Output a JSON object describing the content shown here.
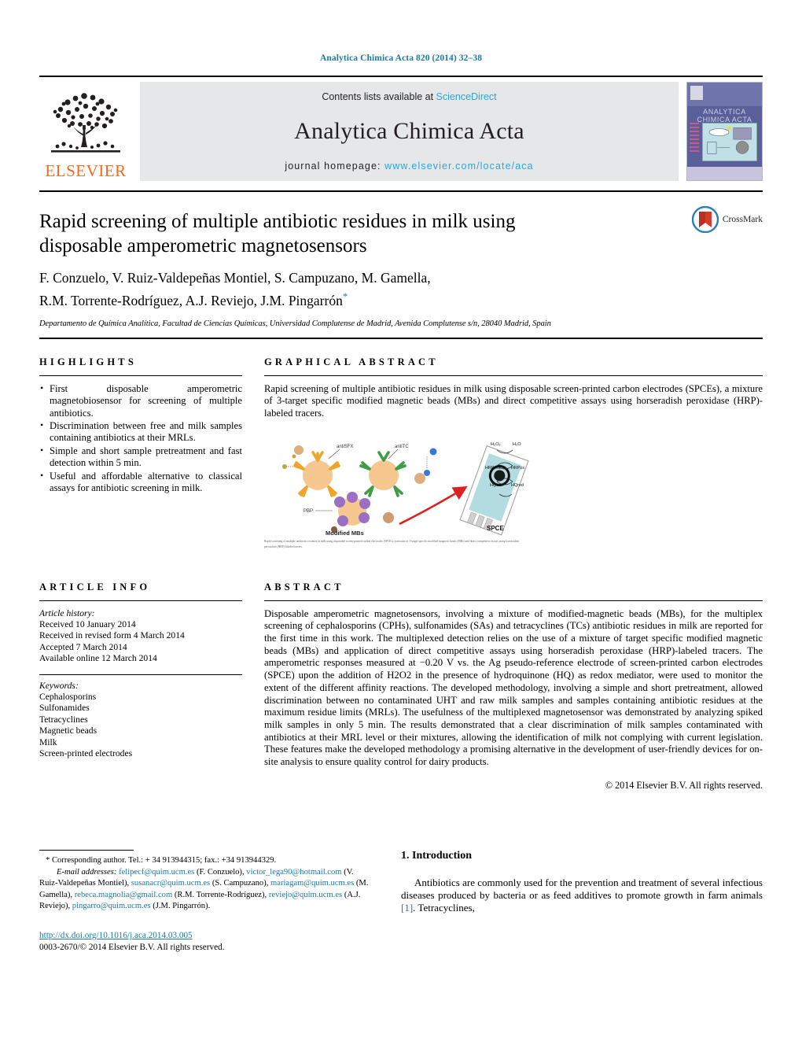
{
  "running_head": "Analytica Chimica Acta 820 (2014) 32–38",
  "masthead": {
    "publisher": "ELSEVIER",
    "contents_prefix": "Contents lists available at ",
    "contents_link": "ScienceDirect",
    "journal_name": "Analytica Chimica Acta",
    "homepage_prefix": "journal homepage: ",
    "homepage_url": "www.elsevier.com/locate/aca",
    "cover_title": "ANALYTICA CHIMICA ACTA",
    "link_color": "#2ba6de"
  },
  "title": "Rapid screening of multiple antibiotic residues in milk using disposable amperometric magnetosensors",
  "authors_line1": "F. Conzuelo, V. Ruiz-Valdepeñas Montiel, S. Campuzano, M. Gamella,",
  "authors_line2": "R.M. Torrente-Rodríguez, A.J. Reviejo, J.M. Pingarrón",
  "affiliation": "Departamento de Química Analítica, Facultad de Ciencias Químicas, Universidad Complutense de Madrid, Avenida Complutense s/n, 28040 Madrid, Spain",
  "crossmark": {
    "label": "CrossMark"
  },
  "highlights": {
    "heading": "HIGHLIGHTS",
    "items": [
      "First disposable amperometric magnetobiosensor for screening of multiple antibiotics.",
      "Discrimination between free and milk samples containing antibiotics at their MRLs.",
      "Simple and short sample pretreatment and fast detection within 5 min.",
      "Useful and affordable alternative to classical assays for antibiotic screening in milk."
    ]
  },
  "graphical_abstract": {
    "heading": "GRAPHICAL ABSTRACT",
    "description": "Rapid screening of multiple antibiotic residues in milk using disposable screen-printed carbon electrodes (SPCEs), a mixture of 3-target specific modified magnetic beads (MBs) and direct competitive assays using horseradish peroxidase (HRP)-labeled tracers.",
    "caption": "Rapid screening of multiple antibiotic residues in milk using disposable screen-printed carbon electrodes (SPCEs), a mixture of 3-target specific modified magnetic beads (MBs) and direct competitive assays using horseradish peroxidase (HRP)-labeled tracers.",
    "figure_labels": {
      "anti_sfy": "antiSFX",
      "anti_tc": "antiTC",
      "pbp": "PBP",
      "modified_mbs": "Modified MBs",
      "spce": "SPCE",
      "h2o2": "H₂O₂",
      "h2o": "H₂O",
      "hrp_red": "HRPred",
      "hrp_ox": "HRPox",
      "hq_ox": "HQox",
      "hq_red": "HQred"
    }
  },
  "article_info": {
    "heading": "ARTICLE INFO",
    "history_label": "Article history:",
    "history": [
      "Received 10 January 2014",
      "Received in revised form 4 March 2014",
      "Accepted 7 March 2014",
      "Available online 12 March 2014"
    ],
    "keywords_label": "Keywords:",
    "keywords": [
      "Cephalosporins",
      "Sulfonamides",
      "Tetracyclines",
      "Magnetic beads",
      "Milk",
      "Screen-printed electrodes"
    ]
  },
  "abstract": {
    "heading": "ABSTRACT",
    "text": "Disposable amperometric magnetosensors, involving a mixture of modified-magnetic beads (MBs), for the multiplex screening of cephalosporins (CPHs), sulfonamides (SAs) and tetracyclines (TCs) antibiotic residues in milk are reported for the first time in this work. The multiplexed detection relies on the use of a mixture of target specific modified magnetic beads (MBs) and application of direct competitive assays using horseradish peroxidase (HRP)-labeled tracers. The amperometric responses measured at −0.20 V vs. the Ag pseudo-reference electrode of screen-printed carbon electrodes (SPCE) upon the addition of H2O2 in the presence of hydroquinone (HQ) as redox mediator, were used to monitor the extent of the different affinity reactions. The developed methodology, involving a simple and short pretreatment, allowed discrimination between no contaminated UHT and raw milk samples and samples containing antibiotic residues at the maximum residue limits (MRLs). The usefulness of the multiplexed magnetosensor was demonstrated by analyzing spiked milk samples in only 5 min. The results demonstrated that a clear discrimination of milk samples contaminated with antibiotics at their MRL level or their mixtures, allowing the identification of milk not complying with current legislation. These features make the developed methodology a promising alternative in the development of user-friendly devices for on-site analysis to ensure quality control for dairy products.",
    "copyright": "© 2014 Elsevier B.V. All rights reserved."
  },
  "footnote": {
    "corresponding": "* Corresponding author. Tel.: + 34 913944315; fax.: +34 913944329.",
    "email_label": "E-mail addresses:",
    "emails": [
      {
        "address": "felipecf@quim.ucm.es",
        "person": "(F. Conzuelo),"
      },
      {
        "address": "victor_lega90@hotmail.com",
        "person": "(V. Ruiz-Valdepeñas Montiel),"
      },
      {
        "address": "susanacr@quim.ucm.es",
        "person": "(S. Campuzano),"
      },
      {
        "address": "mariagam@quim.ucm.es",
        "person": "(M. Gamella),"
      },
      {
        "address": "rebeca.magnolia@gmail.com",
        "person": "(R.M. Torrente-Rodríguez),"
      },
      {
        "address": "reviejo@quim.ucm.es",
        "person": "(A.J. Reviejo),"
      },
      {
        "address": "pingarro@quim.ucm.es",
        "person": "(J.M. Pingarrón)."
      }
    ]
  },
  "doi": {
    "url": "http://dx.doi.org/10.1016/j.aca.2014.03.005",
    "issn_line": "0003-2670/© 2014 Elsevier B.V. All rights reserved."
  },
  "introduction": {
    "heading": "1. Introduction",
    "paragraph_part1": "Antibiotics are commonly used for the prevention and treatment of several infectious diseases produced by bacteria or as feed additives to promote growth in farm animals ",
    "reference": "[1]",
    "paragraph_part2": ". Tetracyclines,"
  }
}
